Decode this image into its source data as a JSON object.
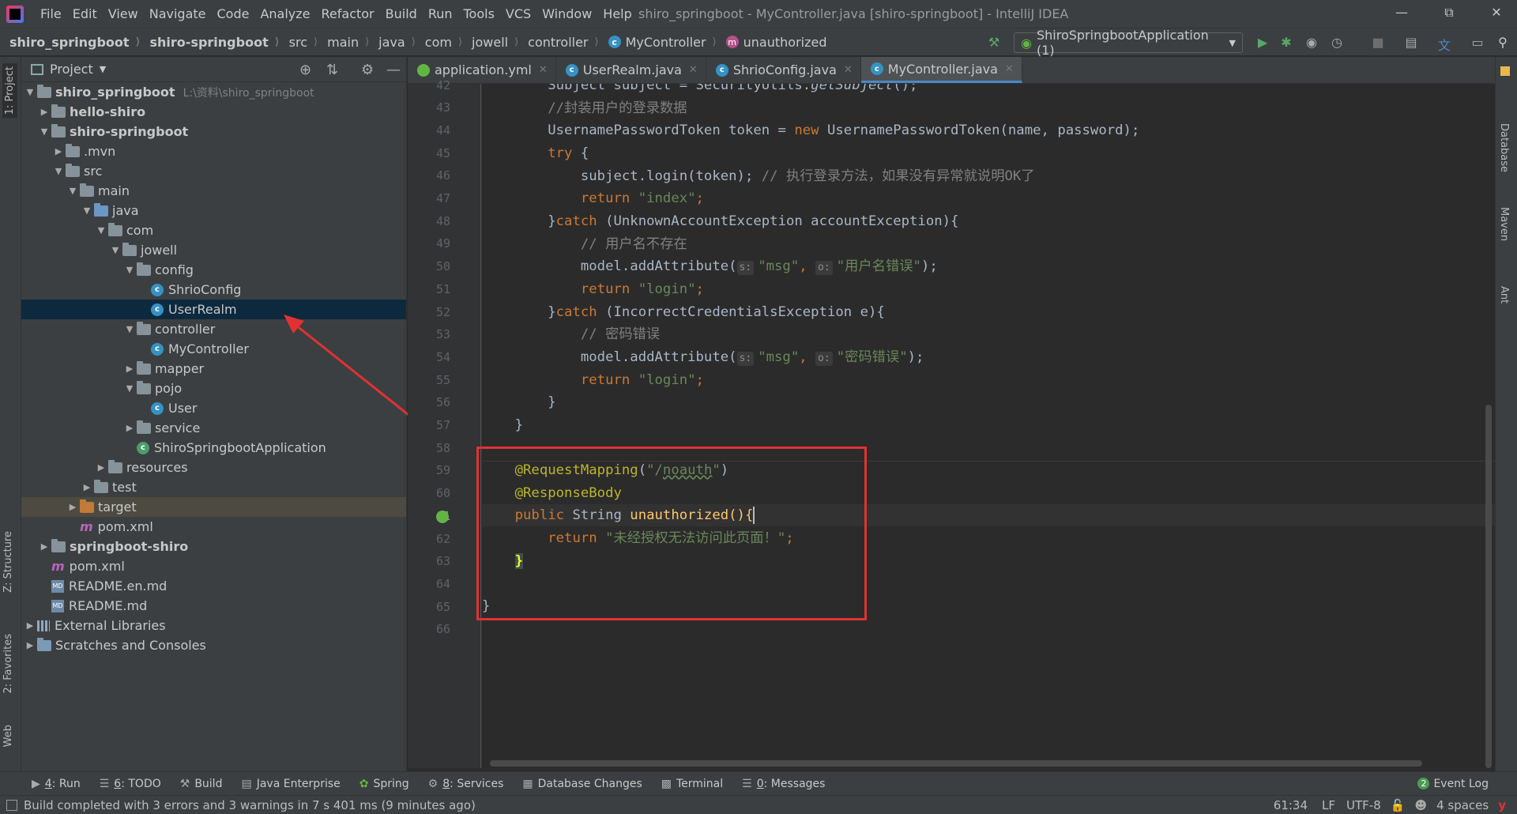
{
  "app": {
    "window_title": "shiro_springboot - MyController.java [shiro-springboot] - IntelliJ IDEA",
    "menu": [
      "File",
      "Edit",
      "View",
      "Navigate",
      "Code",
      "Analyze",
      "Refactor",
      "Build",
      "Run",
      "Tools",
      "VCS",
      "Window",
      "Help"
    ]
  },
  "breadcrumb": [
    "shiro_springboot",
    "shiro-springboot",
    "src",
    "main",
    "java",
    "com",
    "jowell",
    "controller",
    "MyController",
    "unauthorized"
  ],
  "run_config": "ShiroSpringbootApplication (1)",
  "left_strip": {
    "project": "1: Project",
    "structure": "Z: Structure",
    "favorites": "2: Favorites",
    "web": "Web"
  },
  "right_strip": {
    "database": "Database",
    "maven": "Maven",
    "ant": "Ant"
  },
  "project_panel": {
    "title": "Project",
    "tree": [
      {
        "label": "shiro_springboot",
        "extra": "L:\\资料\\shiro_springboot"
      },
      {
        "label": "hello-shiro"
      },
      {
        "label": "shiro-springboot"
      },
      {
        "label": ".mvn"
      },
      {
        "label": "src"
      },
      {
        "label": "main"
      },
      {
        "label": "java"
      },
      {
        "label": "com"
      },
      {
        "label": "jowell"
      },
      {
        "label": "config"
      },
      {
        "label": "ShrioConfig"
      },
      {
        "label": "UserRealm"
      },
      {
        "label": "controller"
      },
      {
        "label": "MyController"
      },
      {
        "label": "mapper"
      },
      {
        "label": "pojo"
      },
      {
        "label": "User"
      },
      {
        "label": "service"
      },
      {
        "label": "ShiroSpringbootApplication"
      },
      {
        "label": "resources"
      },
      {
        "label": "test"
      },
      {
        "label": "target"
      },
      {
        "label": "pom.xml"
      },
      {
        "label": "springboot-shiro"
      },
      {
        "label": "pom.xml"
      },
      {
        "label": "README.en.md"
      },
      {
        "label": "README.md"
      },
      {
        "label": "External Libraries"
      },
      {
        "label": "Scratches and Consoles"
      }
    ]
  },
  "editor_tabs": [
    {
      "label": "application.yml",
      "active": false
    },
    {
      "label": "UserRealm.java",
      "active": false
    },
    {
      "label": "ShrioConfig.java",
      "active": false
    },
    {
      "label": "MyController.java",
      "active": true
    }
  ],
  "line_numbers": [
    "42",
    "43",
    "44",
    "45",
    "46",
    "47",
    "48",
    "49",
    "50",
    "51",
    "52",
    "53",
    "54",
    "55",
    "56",
    "57",
    "58",
    "59",
    "60",
    "61",
    "62",
    "63",
    "64",
    "65",
    "66"
  ],
  "current_line": "61",
  "code": {
    "l42_a": "Subject subject = SecurityUtils.",
    "l42_b": "getSubject",
    "l42_c": "();",
    "l43": "//封装用户的登录数据",
    "l44_a": "UsernamePasswordToken token = ",
    "l44_new": "new",
    "l44_b": " UsernamePasswordToken(name, password);",
    "l45_kw": "try",
    "l45_b": " {",
    "l46_a": "subject.login(token); ",
    "l46_c": "// 执行登录方法，如果没有异常就说明OK了",
    "l47_kw": "return",
    "l47_s": "\"index\"",
    "l48_a": "}",
    "l48_kw": "catch",
    "l48_b": " (UnknownAccountException accountException){",
    "l49": "// 用户名不存在",
    "l50_a": "model.addAttribute(",
    "l50_h1": "s:",
    "l50_s1": "\"msg\"",
    "l50_h2": "o:",
    "l50_s2": "\"用户名错误\"",
    "l50_b": ");",
    "l51_kw": "return",
    "l51_s": "\"login\"",
    "l52_a": "}",
    "l52_kw": "catch",
    "l52_b": " (IncorrectCredentialsException e){",
    "l53": "// 密码错误",
    "l54_a": "model.addAttribute(",
    "l54_h1": "s:",
    "l54_s1": "\"msg\"",
    "l54_h2": "o:",
    "l54_s2": "\"密码错误\"",
    "l54_b": ");",
    "l55_kw": "return",
    "l55_s": "\"login\"",
    "l56": "}",
    "l57": "}",
    "l59_ann": "@RequestMapping",
    "l59_a": "(",
    "l59_s1": "\"/",
    "l59_s2": "noauth",
    "l59_s3": "\"",
    "l59_b": ")",
    "l60_ann": "@ResponseBody",
    "l61_kw": "public",
    "l61_a": " String ",
    "l61_fn": "unauthorized",
    "l61_b": "(){",
    "l62_kw": "return",
    "l62_s": "\"未经授权无法访问此页面！\"",
    "l62_b": ";",
    "l63": "}",
    "l65": "}"
  },
  "tool_windows": [
    {
      "key": "4",
      "label": ": Run"
    },
    {
      "key": "6",
      "label": ": TODO"
    },
    {
      "key": "",
      "label": "Build"
    },
    {
      "key": "",
      "label": "Java Enterprise"
    },
    {
      "key": "",
      "label": "Spring"
    },
    {
      "key": "8",
      "label": ": Services"
    },
    {
      "key": "",
      "label": "Database Changes"
    },
    {
      "key": "",
      "label": "Terminal"
    },
    {
      "key": "0",
      "label": ": Messages"
    }
  ],
  "event_log": {
    "count": "2",
    "label": "Event Log"
  },
  "status": {
    "message": "Build completed with 3 errors and 3 warnings in 7 s 401 ms (9 minutes ago)",
    "position": "61:34",
    "line_sep": "LF",
    "encoding": "UTF-8",
    "indent": "4 spaces"
  },
  "colors": {
    "annotation_box": "#e03232",
    "selection": "#0d293e",
    "accent": "#4a88c7"
  }
}
